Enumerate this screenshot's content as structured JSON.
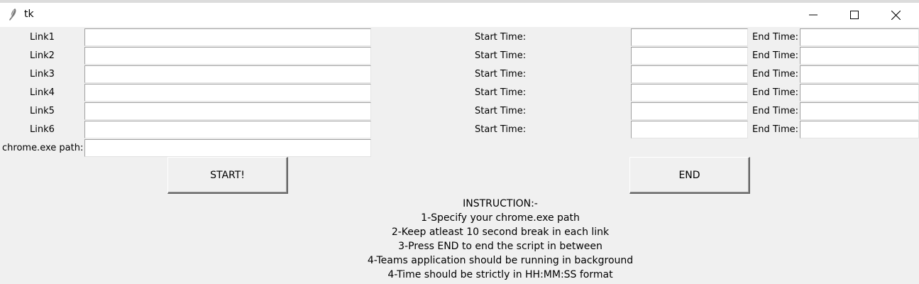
{
  "window": {
    "title": "tk"
  },
  "links": [
    {
      "label": "Link1",
      "start_label": "Start Time:",
      "end_label": "End Time:",
      "url": "",
      "start": "",
      "end": ""
    },
    {
      "label": "Link2",
      "start_label": "Start Time:",
      "end_label": "End Time:",
      "url": "",
      "start": "",
      "end": ""
    },
    {
      "label": "Link3",
      "start_label": "Start Time:",
      "end_label": "End Time:",
      "url": "",
      "start": "",
      "end": ""
    },
    {
      "label": "Link4",
      "start_label": "Start Time:",
      "end_label": "End Time:",
      "url": "",
      "start": "",
      "end": ""
    },
    {
      "label": "Link5",
      "start_label": "Start Time:",
      "end_label": "End Time:",
      "url": "",
      "start": "",
      "end": ""
    },
    {
      "label": "Link6",
      "start_label": "Start Time:",
      "end_label": "End Time:",
      "url": "",
      "start": "",
      "end": ""
    }
  ],
  "chrome": {
    "label": "chrome.exe path:",
    "value": ""
  },
  "buttons": {
    "start": "START!",
    "end": "END"
  },
  "instructions": [
    "INSTRUCTION:-",
    "1-Specify your chrome.exe path",
    "2-Keep atleast 10 second break in each link",
    "3-Press END to end the script in between",
    "4-Teams application should be running in background",
    "4-Time should be strictly in HH:MM:SS format"
  ],
  "icons": {
    "app": "tk-feather-icon",
    "minimize": "minimize-icon",
    "maximize": "maximize-icon",
    "close": "close-icon"
  }
}
